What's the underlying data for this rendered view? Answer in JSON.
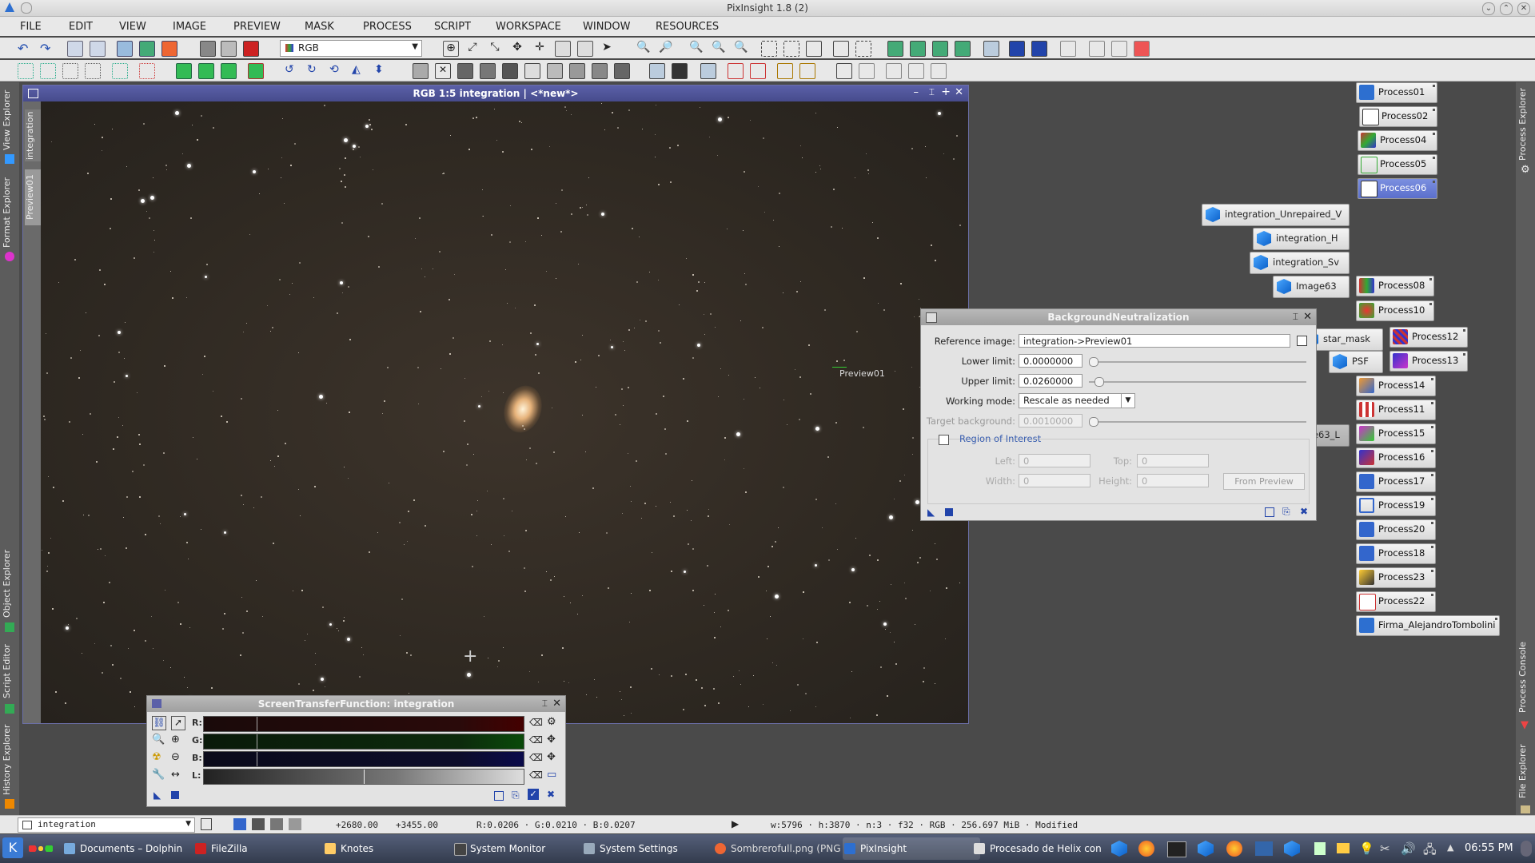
{
  "window": {
    "title": "PixInsight 1.8 (2)"
  },
  "menu": [
    "FILE",
    "EDIT",
    "VIEW",
    "IMAGE",
    "PREVIEW",
    "MASK",
    "PROCESS",
    "SCRIPT",
    "WORKSPACE",
    "WINDOW",
    "RESOURCES"
  ],
  "toolbar": {
    "color_space_value": "RGB"
  },
  "left_dock_tabs": [
    "View Explorer",
    "Format Explorer",
    "Object Explorer",
    "Script Editor",
    "History Explorer"
  ],
  "right_dock_tabs": [
    "Process Explorer",
    "Process Console",
    "File Explorer"
  ],
  "image_window": {
    "title": "RGB 1:5 integration | <*new*>",
    "side_tabs": [
      "integration",
      "Preview01"
    ],
    "preview_label": "Preview01"
  },
  "process_icons": [
    "Process01",
    "Process02",
    "Process04",
    "Process05",
    "Process06",
    "Process08",
    "Process10",
    "Process12",
    "Process13",
    "Process14",
    "Process11",
    "Process15",
    "Process16",
    "Process17",
    "Process19",
    "Process20",
    "Process18",
    "Process23",
    "Process22",
    "Firma_AlejandroTombolini"
  ],
  "image_icons": [
    "integration_Unrepaired_V",
    "integration_H",
    "integration_Sv",
    "Image63",
    "star_mask",
    "PSF",
    "Image63_L"
  ],
  "bn_dialog": {
    "title": "BackgroundNeutralization",
    "reference_label": "Reference image:",
    "reference_value": "integration->Preview01",
    "lower_label": "Lower limit:",
    "lower_value": "0.0000000",
    "upper_label": "Upper limit:",
    "upper_value": "0.0260000",
    "mode_label": "Working mode:",
    "mode_value": "Rescale as needed",
    "target_label": "Target background:",
    "target_value": "0.0010000",
    "roi_label": "Region of Interest",
    "left_label": "Left:",
    "left_value": "0",
    "top_label": "Top:",
    "top_value": "0",
    "width_label": "Width:",
    "width_value": "0",
    "height_label": "Height:",
    "height_value": "0",
    "from_preview_label": "From Preview"
  },
  "stf": {
    "title": "ScreenTransferFunction: integration",
    "channels": [
      "R:",
      "G:",
      "B:",
      "L:"
    ]
  },
  "status": {
    "view": "integration",
    "x": "+2680.00",
    "y": "+3455.00",
    "rgb": "R:0.0206 · G:0.0210 · B:0.0207",
    "info": "w:5796 · h:3870 · n:3 · f32 · RGB · 256.697 MiB · Modified"
  },
  "taskbar": {
    "tasks": [
      "Documents – Dolphin",
      "FileZilla",
      "Knotes",
      "System Monitor",
      "System Settings",
      "Sombrerofull.png (PNG",
      "PixInsight",
      "Procesado de Helix con"
    ],
    "clock": "06:55 PM"
  }
}
